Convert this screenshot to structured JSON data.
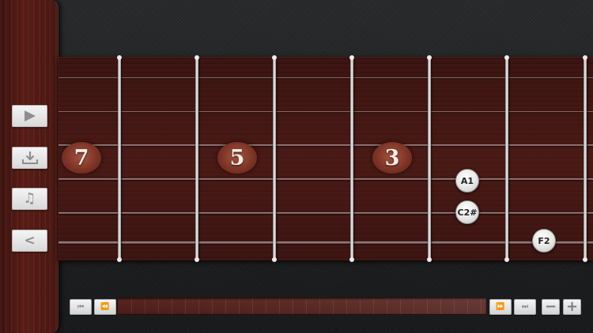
{
  "side_panel": {
    "buttons": [
      {
        "name": "play",
        "icon": "play-icon"
      },
      {
        "name": "download",
        "icon": "download-icon"
      },
      {
        "name": "music",
        "icon": "music-note-icon",
        "glyph": "♫"
      },
      {
        "name": "back",
        "icon": "back-chevron-icon",
        "glyph": "<"
      }
    ]
  },
  "fretboard": {
    "fret_markers": [
      "7",
      "5",
      "3"
    ],
    "notes": [
      "A1",
      "C2#",
      "F2"
    ]
  },
  "transport": {
    "skip_start_glyph": "⏮",
    "rewind_glyph": "⏪",
    "forward_glyph": "⏩",
    "skip_end_glyph": "⏭",
    "zoom_out_glyph": "−",
    "zoom_in_glyph": "+"
  },
  "colors": {
    "wood": "#4a1a16",
    "fret_metal": "#e6e6e6",
    "note_dot": "#e6e6e6"
  }
}
